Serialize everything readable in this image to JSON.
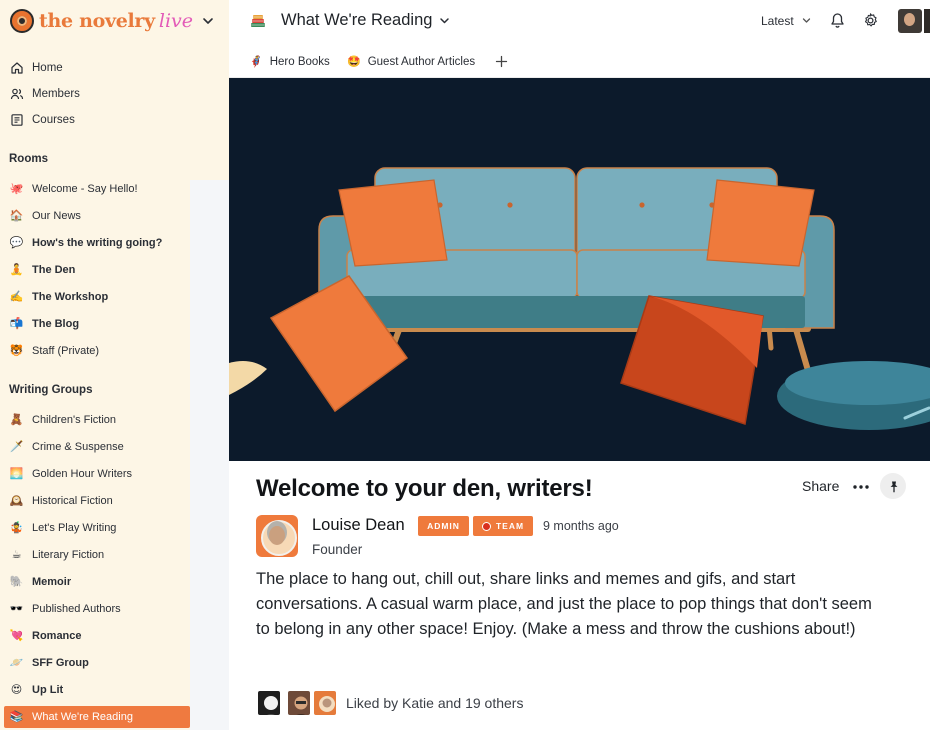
{
  "brand": {
    "name": "the novelry",
    "suffix": "live"
  },
  "nav": [
    {
      "label": "Home",
      "icon": "home-icon"
    },
    {
      "label": "Members",
      "icon": "members-icon"
    },
    {
      "label": "Courses",
      "icon": "courses-icon"
    }
  ],
  "rooms_section": {
    "title": "Rooms",
    "items": [
      {
        "label": "Welcome - Say Hello!",
        "emoji": "🐙",
        "bold": false
      },
      {
        "label": "Our News",
        "emoji": "🏠",
        "bold": false
      },
      {
        "label": "How's the writing going?",
        "emoji": "💬",
        "bold": true
      },
      {
        "label": "The Den",
        "emoji": "🧘",
        "bold": true
      },
      {
        "label": "The Workshop",
        "emoji": "✍️",
        "bold": true
      },
      {
        "label": "The Blog",
        "emoji": "📬",
        "bold": true
      },
      {
        "label": "Staff (Private)",
        "emoji": "🐯",
        "bold": false
      }
    ]
  },
  "groups_section": {
    "title": "Writing Groups",
    "items": [
      {
        "label": "Children's Fiction",
        "emoji": "🧸",
        "bold": false
      },
      {
        "label": "Crime & Suspense",
        "emoji": "🗡️",
        "bold": false
      },
      {
        "label": "Golden Hour Writers",
        "emoji": "🌅",
        "bold": false
      },
      {
        "label": "Historical Fiction",
        "emoji": "🕰️",
        "bold": false
      },
      {
        "label": "Let's Play Writing",
        "emoji": "🤹",
        "bold": false
      },
      {
        "label": "Literary Fiction",
        "emoji": "☕",
        "bold": false
      },
      {
        "label": "Memoir",
        "emoji": "🐘",
        "bold": true
      },
      {
        "label": "Published Authors",
        "emoji": "🕶️",
        "bold": false
      },
      {
        "label": "Romance",
        "emoji": "💘",
        "bold": true
      },
      {
        "label": "SFF Group",
        "emoji": "🪐",
        "bold": true
      },
      {
        "label": "Up Lit",
        "emoji": "😍",
        "bold": true
      },
      {
        "label": "What We're Reading",
        "emoji": "📚",
        "bold": false,
        "active": true
      }
    ]
  },
  "header": {
    "title": "What We're Reading",
    "icon": "books-icon",
    "sort_label": "Latest"
  },
  "tabs": [
    {
      "label": "Hero Books",
      "emoji": "🦸"
    },
    {
      "label": "Guest Author Articles",
      "emoji": "🤩"
    }
  ],
  "post": {
    "title": "Welcome to your den, writers!",
    "share_label": "Share",
    "author": {
      "name": "Louise Dean",
      "role": "Founder",
      "badges": [
        "ADMIN",
        "TEAM"
      ]
    },
    "time": "9 months ago",
    "body": "The place to hang out, chill out, share links and memes and gifs, and start conversations. A casual warm place, and just the place to pop things that don't seem to belong in any other space! Enjoy. (Make a mess and throw the cushions about!)",
    "likes_text": "Liked by Katie and 19 others"
  },
  "colors": {
    "accent": "#ef7a40",
    "sidebar_bg": "#fdf6e6",
    "hero_bg": "#0c1a2b",
    "sofa": "#79aebd",
    "cushion": "#ef7a3c"
  }
}
